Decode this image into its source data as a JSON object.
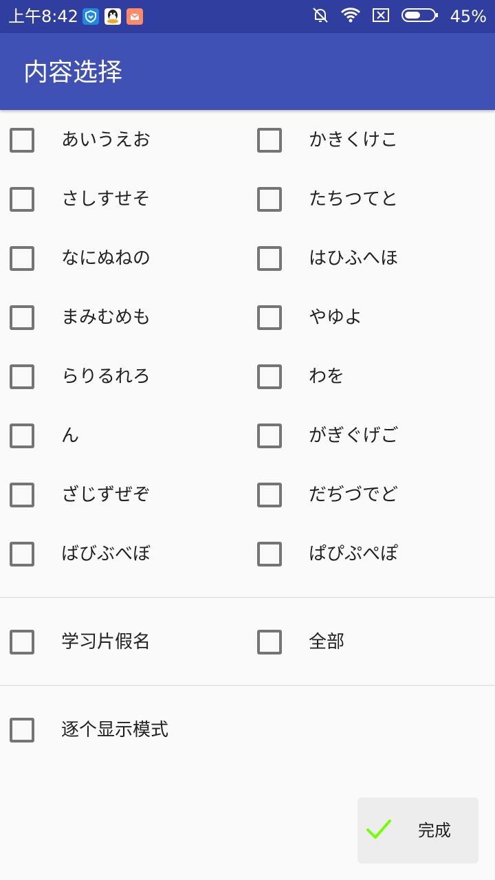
{
  "status_bar": {
    "time": "上午8:42",
    "battery": "45%",
    "left_icons": [
      "shield-icon",
      "qq-icon",
      "mail-app-icon"
    ],
    "right_icons": [
      "mute-bell-icon",
      "wifi-icon",
      "no-sim-icon",
      "battery-icon"
    ]
  },
  "app_bar": {
    "title": "内容选择"
  },
  "kana": {
    "left": [
      "あいうえお",
      "さしすせそ",
      "なにぬねの",
      "まみむめも",
      "らりるれろ",
      "ん",
      "ざじずぜぞ",
      "ばびぶべぼ"
    ],
    "right": [
      "かきくけこ",
      "たちつてと",
      "はひふへほ",
      "やゆよ",
      "わを",
      "がぎぐげご",
      "だぢづでど",
      "ぱぴぷぺぽ"
    ]
  },
  "options": {
    "katakana": "学习片假名",
    "all": "全部",
    "one_by_one": "逐个显示模式"
  },
  "done_button": {
    "label": "完成"
  },
  "colors": {
    "status_bar": "#303f9f",
    "app_bar": "#3f51b5",
    "checkbox_border": "#757575",
    "check_mark": "#76ff03"
  }
}
